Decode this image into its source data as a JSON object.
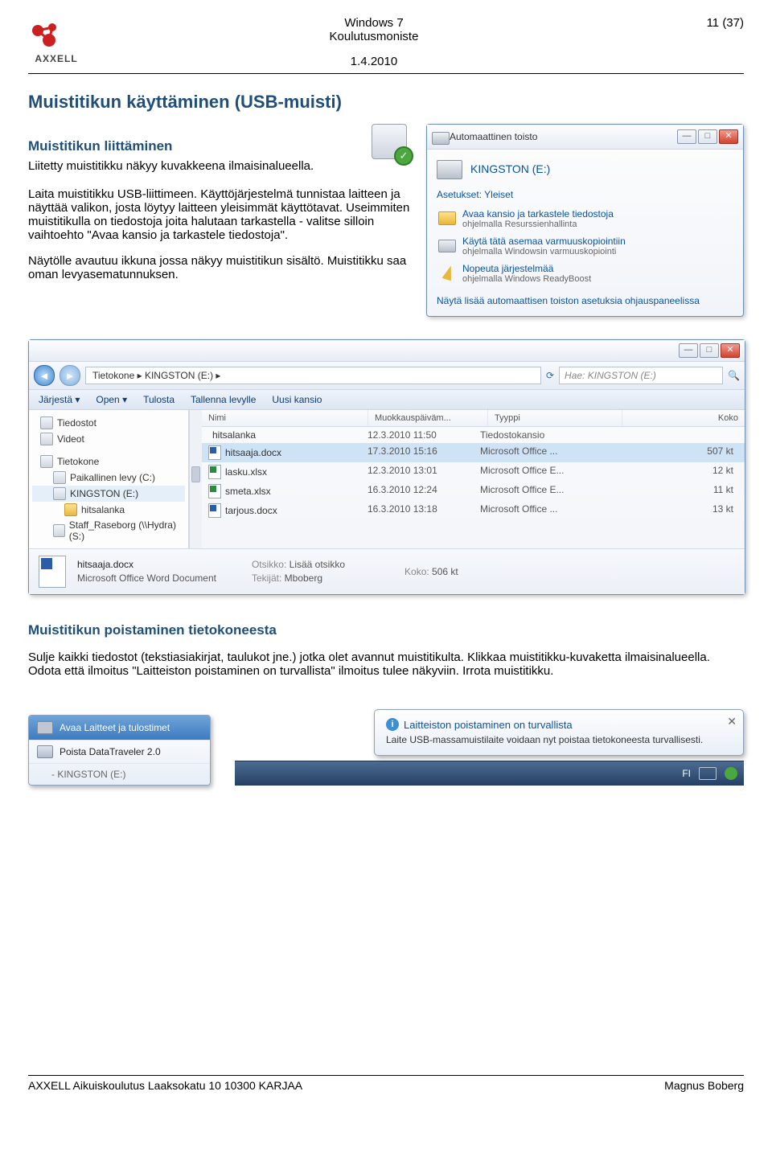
{
  "header": {
    "center_line1": "Windows 7",
    "center_line2": "Koulutusmoniste",
    "date": "1.4.2010",
    "page": "11 (37)",
    "logo_text": "AXXELL"
  },
  "section_title": "Muistitikun käyttäminen (USB-muisti)",
  "sub1_title": "Muistitikun liittäminen",
  "sub1_text": "Liitetty muistitikku näkyy kuvakkeena ilmaisinalueella.",
  "para2": "Laita muistitikku USB-liittimeen. Käyttöjärjestelmä tunnistaa laitteen ja näyttää valikon, josta löytyy laitteen yleisimmät käyttötavat. Useimmiten muistitikulla on tiedostoja joita halutaan tarkastella - valitse silloin vaihtoehto \"Avaa kansio ja tarkastele tiedostoja\".",
  "para3": "Näytölle avautuu ikkuna jossa näkyy muistitikun sisältö. Muistitikku saa oman levyasematunnuksen.",
  "autoplay": {
    "title": "Automaattinen toisto",
    "drive": "KINGSTON (E:)",
    "group": "Asetukset: Yleiset",
    "opt1a": "Avaa kansio ja tarkastele tiedostoja",
    "opt1b": "ohjelmalla Resurssienhallinta",
    "opt2a": "Käytä tätä asemaa varmuuskopiointiin",
    "opt2b": "ohjelmalla Windowsin varmuuskopiointi",
    "opt3a": "Nopeuta järjestelmää",
    "opt3b": "ohjelmalla Windows ReadyBoost",
    "link": "Näytä lisää automaattisen toiston asetuksia ohjauspaneelissa"
  },
  "explorer": {
    "back_glyph": "◄",
    "fwd_glyph": "►",
    "crumb": "Tietokone  ▸  KINGSTON (E:)  ▸",
    "refresh_glyph": "⟳",
    "search_placeholder": "Hae: KINGSTON (E:)",
    "search_glyph": "🔍",
    "cmd": {
      "organize": "Järjestä ▾",
      "open": "Open ▾",
      "print": "Tulosta",
      "save": "Tallenna levylle",
      "new": "Uusi kansio"
    },
    "tree": [
      {
        "label": "Tiedostot",
        "sub": false
      },
      {
        "label": "Videot",
        "sub": false
      },
      {
        "label": "",
        "sub": false,
        "spacer": true
      },
      {
        "label": "Tietokone",
        "sub": false
      },
      {
        "label": "Paikallinen levy (C:)",
        "sub": true
      },
      {
        "label": "KINGSTON (E:)",
        "sub": true,
        "highlight": true
      },
      {
        "label": "hitsalanka",
        "sub": true,
        "folder": true,
        "deep": true
      },
      {
        "label": "Staff_Raseborg (\\\\Hydra) (S:)",
        "sub": true
      }
    ],
    "headers": {
      "name": "Nimi",
      "mod": "Muokkauspäiväm...",
      "type": "Tyyppi",
      "size": "Koko"
    },
    "rows": [
      {
        "name": "hitsalanka",
        "mod": "12.3.2010 11:50",
        "type": "Tiedostokansio",
        "size": "",
        "kind": "folder"
      },
      {
        "name": "hitsaaja.docx",
        "mod": "17.3.2010 15:16",
        "type": "Microsoft Office ...",
        "size": "507 kt",
        "kind": "w",
        "sel": true
      },
      {
        "name": "lasku.xlsx",
        "mod": "12.3.2010 13:01",
        "type": "Microsoft Office E...",
        "size": "12 kt",
        "kind": "x"
      },
      {
        "name": "smeta.xlsx",
        "mod": "16.3.2010 12:24",
        "type": "Microsoft Office E...",
        "size": "11 kt",
        "kind": "x"
      },
      {
        "name": "tarjous.docx",
        "mod": "16.3.2010 13:18",
        "type": "Microsoft Office ...",
        "size": "13 kt",
        "kind": "w"
      }
    ],
    "detail": {
      "name": "hitsaaja.docx",
      "doctype": "Microsoft Office Word Document",
      "otsikko_lbl": "Otsikko:",
      "otsikko_val": "Lisää otsikko",
      "tekijat_lbl": "Tekijät:",
      "tekijat_val": "Mboberg",
      "koko_lbl": "Koko:",
      "koko_val": "506 kt"
    }
  },
  "sub2_title": "Muistitikun poistaminen tietokoneesta",
  "para4": "Sulje kaikki tiedostot (tekstiasiakirjat, taulukot jne.) jotka olet avannut muistitikulta. Klikkaa muistitikku-kuvaketta ilmaisinalueella. Odota että ilmoitus \"Laitteiston poistaminen on turvallista\" ilmoitus tulee näkyviin. Irrota muistitikku.",
  "context_menu": {
    "top": "Avaa Laitteet ja tulostimet",
    "item": "Poista DataTraveler 2.0",
    "sub": "-   KINGSTON (E:)"
  },
  "balloon": {
    "title": "Laitteiston poistaminen on turvallista",
    "body": "Laite USB-massamuistilaite voidaan nyt poistaa tietokoneesta turvallisesti.",
    "close_glyph": "✕",
    "info_glyph": "i"
  },
  "tray": {
    "lang": "FI"
  },
  "footer": {
    "left": "AXXELL Aikuiskoulutus Laaksokatu 10 10300 KARJAA",
    "right": "Magnus Boberg"
  }
}
